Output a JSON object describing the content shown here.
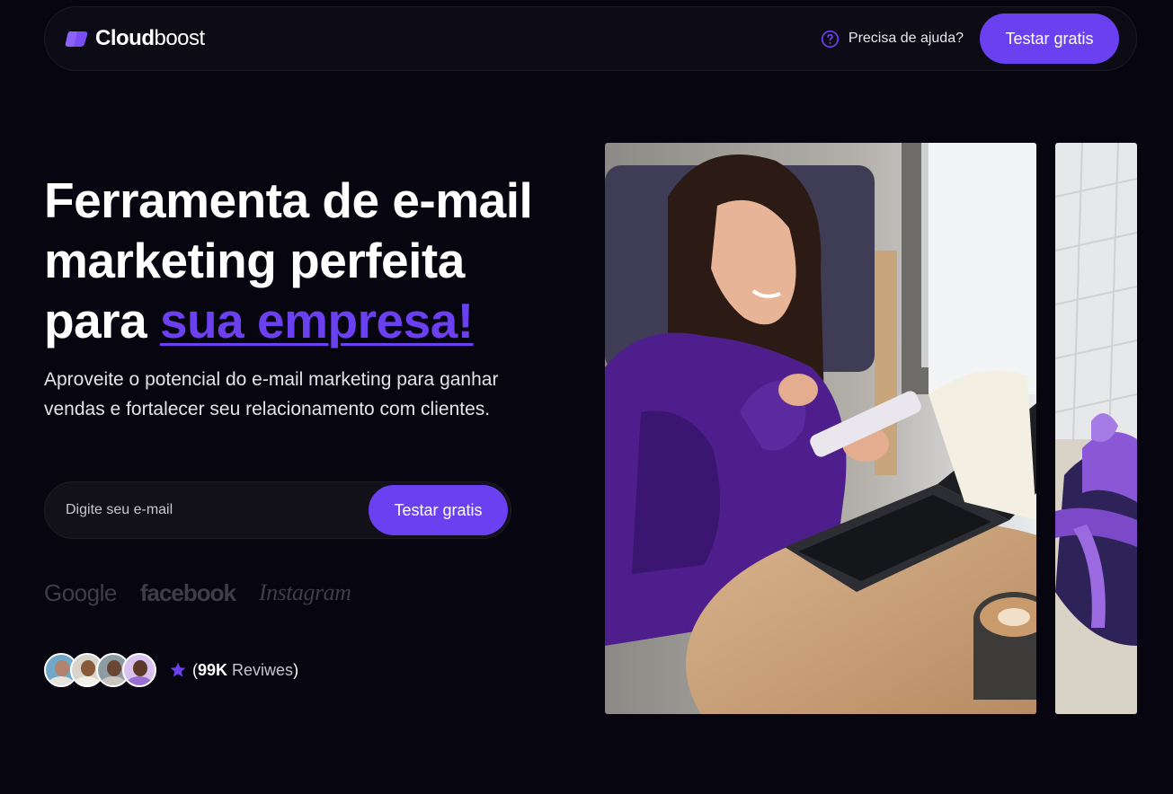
{
  "header": {
    "brand": {
      "name_bold": "Cloud",
      "name_light": "boost",
      "logo_icon": "cloud-icon"
    },
    "help_label": "Precisa de ajuda?",
    "help_icon": "question-circle-icon",
    "cta_label": "Testar gratis"
  },
  "hero": {
    "title_line1": "Ferramenta de e-mail",
    "title_line2": "marketing perfeita",
    "title_prefix": "para ",
    "title_accent": "sua empresa!",
    "subtitle": "Aproveite o potencial do e-mail marketing para ganhar vendas e fortalecer seu relacionamento com clientes."
  },
  "signup": {
    "placeholder": "Digite seu e-mail",
    "value": "",
    "cta_label": "Testar gratis"
  },
  "partners": [
    "Google",
    "facebook",
    "Instagram"
  ],
  "reviews": {
    "avatars": [
      "avatar-1",
      "avatar-2",
      "avatar-3",
      "avatar-4"
    ],
    "icon": "star-icon",
    "open_paren": "(",
    "count": "99K",
    "label": " Reviwes",
    "close_paren": ")"
  },
  "images": {
    "main": "woman-with-phone-and-laptop",
    "side": "purple-gift-box"
  },
  "colors": {
    "background": "#07050f",
    "accent": "#6b40f0",
    "nav_bg": "#0d0b15",
    "muted_logo": "#3f3d48"
  }
}
